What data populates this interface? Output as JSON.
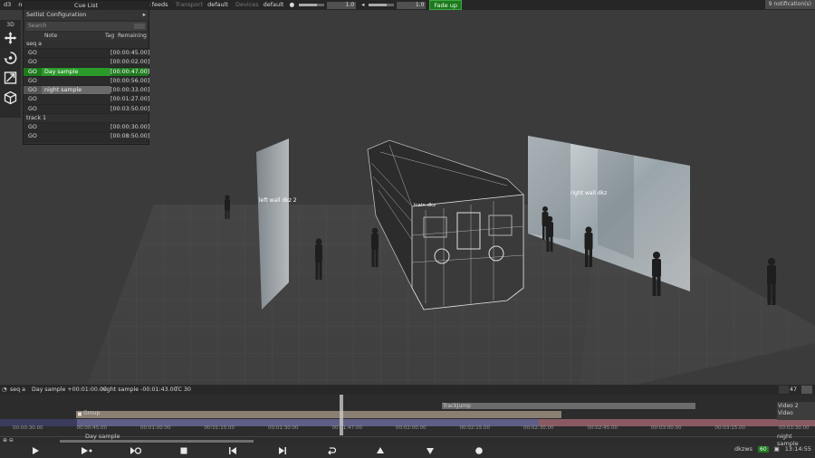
{
  "topbar": {
    "app": "d3",
    "net": "net",
    "cue_list": "Cue List",
    "feeds": "dkzws feeds",
    "transport_label": "Transport",
    "transport_value": "default",
    "devices_label": "Devices",
    "devices_value": "default",
    "brightness_value": "1.0",
    "volume_value": "1.0",
    "fade_button": "Fade up",
    "notifications": "9 notification(s)"
  },
  "toolbar": {
    "mode": "3D"
  },
  "cuelist": {
    "panel_title": "Setlist Configuration",
    "search_placeholder": "Search",
    "col_note": "Note",
    "col_tag": "Tag",
    "col_remaining": "Remaining",
    "groups": [
      {
        "name": "seq a",
        "rows": [
          {
            "go": "GO",
            "note": "",
            "remaining": "[00:00:45.00]"
          },
          {
            "go": "GO",
            "note": "",
            "remaining": "[00:00:02.00]"
          },
          {
            "go": "GO",
            "note": "Day sample",
            "remaining": "[00:00:47.00]"
          },
          {
            "go": "GO",
            "note": "",
            "remaining": "[00:00:56.00]"
          },
          {
            "go": "GO",
            "note": "night sample",
            "remaining": "[00:00:33.00]"
          },
          {
            "go": "GO",
            "note": "",
            "remaining": "[00:01:27.00]"
          },
          {
            "go": "GO",
            "note": "",
            "remaining": "[00:03:50.00]"
          }
        ]
      },
      {
        "name": "track 1",
        "rows": [
          {
            "go": "GO",
            "note": "",
            "remaining": "[00:00:30.00]"
          },
          {
            "go": "GO",
            "note": "",
            "remaining": "[00:08:50.00]"
          }
        ]
      }
    ]
  },
  "scene": {
    "left_screen_label": "left wall dkz 2",
    "right_screen_label": "right wall dkz",
    "train_label": "train dkz"
  },
  "timeline": {
    "sequence": "seq a",
    "day_sample": "Day sample +00:01:00.00",
    "night_sample": "night sample -00:01:43.00",
    "tc": "TC 30",
    "zoom_value": "47",
    "track_jump": "TrackJump",
    "group": "Group",
    "video2": "Video 2",
    "video": "Video",
    "ticks": [
      "00:00:30.00",
      "00:00:45.00",
      "00:01:00.00",
      "00:01:15.00",
      "00:01:30.00",
      "00:01:47.00",
      "00:02:00.00",
      "00:02:15.00",
      "00:02:30.00",
      "00:02:45.00",
      "00:03:00.00",
      "00:03:15.00",
      "00:03:30.00"
    ],
    "current_cue": "Day sample",
    "next_cue": "night sample"
  },
  "status": {
    "host": "dkzws",
    "fps": "60",
    "time": "13:14:55"
  }
}
